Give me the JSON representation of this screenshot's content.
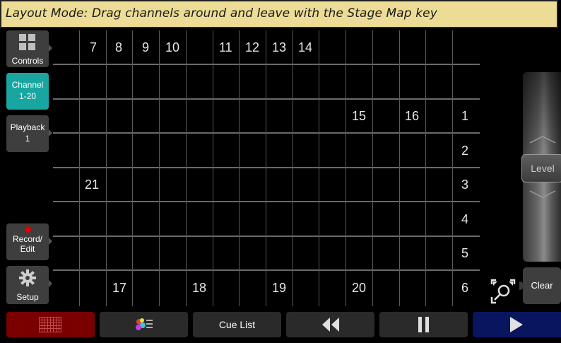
{
  "banner": {
    "text": "Layout Mode: Drag channels around and leave with the Stage Map key"
  },
  "sidebar": {
    "controls": "Controls",
    "channel_line1": "Channel",
    "channel_line2": "1-20",
    "playback_line1": "Playback",
    "playback_line2": "1",
    "record_line1": "Record/",
    "record_line2": "Edit",
    "setup": "Setup"
  },
  "channels": {
    "c7": "7",
    "c8": "8",
    "c9": "9",
    "c10": "10",
    "c11": "11",
    "c12": "12",
    "c13": "13",
    "c14": "14",
    "c15": "15",
    "c16": "16",
    "c1": "1",
    "c2": "2",
    "c21": "21",
    "c3": "3",
    "c4": "4",
    "c5": "5",
    "c17": "17",
    "c18": "18",
    "c19": "19",
    "c20": "20",
    "c6": "6"
  },
  "right_panel": {
    "level_label": "Level",
    "clear_label": "Clear"
  },
  "bottom_bar": {
    "cue_list_label": "Cue List"
  },
  "colors": {
    "banner": "#ecdc96",
    "active_tab": "#1aa6a0",
    "stage_map_button": "#7a0000",
    "go_button": "#0a1560",
    "record_dot": "#e00000"
  },
  "icons": [
    "controls-grid-icon",
    "gear-icon",
    "record-dot-icon",
    "stage-map-grid-icon",
    "color-palette-icon",
    "rewind-icon",
    "pause-icon",
    "play-icon",
    "zoom-fit-icon"
  ]
}
